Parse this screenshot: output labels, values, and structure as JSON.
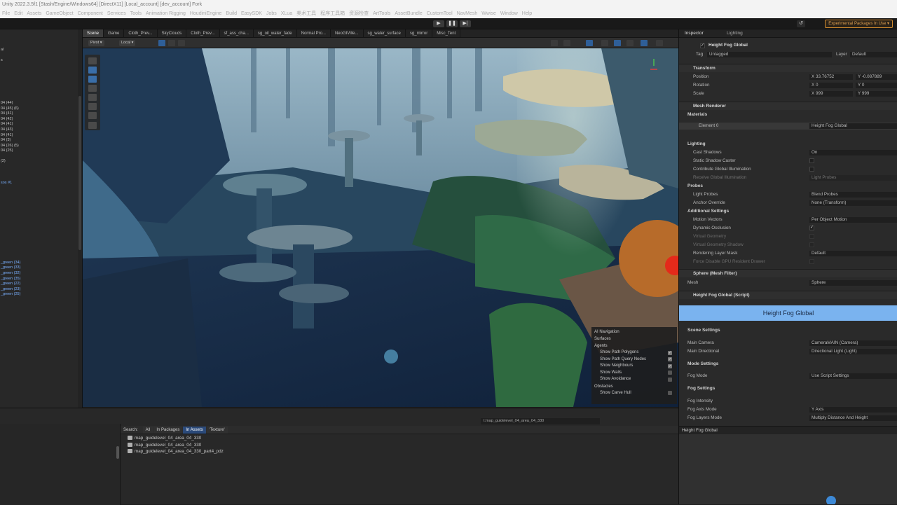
{
  "window": {
    "title": "Unity 2022.3.5f1  [Stash/Engine/Windows64]  [DirectX11]  [Local_account]  [dev_account]  Fork"
  },
  "menu": [
    "File",
    "Edit",
    "Assets",
    "GameObject",
    "Component",
    "Services",
    "Tools",
    "Animation Rigging",
    "HoudiniEngine",
    "Build",
    "EasySDK",
    "Jobs",
    "XLua",
    "美术工具",
    "程序工具箱",
    "资源检查",
    "ArtTools",
    "AssetBundle",
    "CustomTool",
    "NavMesh",
    "Wwise",
    "Window",
    "Help"
  ],
  "toolbar": {
    "experimental_badge": "Experimental Packages In Use ▾"
  },
  "hierarchy": {
    "rows": [
      {
        "text": "al",
        "blue": false
      },
      {
        "text": "",
        "": ""
      },
      {
        "text": "s",
        "blue": false
      },
      {
        "text": "",
        "blue": false
      },
      {
        "text": "",
        "blue": false
      },
      {
        "text": "",
        "blue": false
      },
      {
        "text": "",
        "blue": false
      },
      {
        "text": "",
        "blue": false
      },
      {
        "text": "",
        "blue": false
      },
      {
        "text": "",
        "blue": false
      },
      {
        "text": "04 (44)",
        "blue": false
      },
      {
        "text": "04 (45) (6)",
        "blue": false
      },
      {
        "text": "04 (41)",
        "blue": false
      },
      {
        "text": "04 (42)",
        "blue": false
      },
      {
        "text": "04 (41)",
        "blue": false
      },
      {
        "text": "04 (43)",
        "blue": false
      },
      {
        "text": "04 (41)",
        "blue": false
      },
      {
        "text": "04 (3)",
        "blue": false
      },
      {
        "text": "04 (26) (5)",
        "blue": false
      },
      {
        "text": "04 (25)",
        "blue": false
      },
      {
        "text": "",
        "blue": false
      },
      {
        "text": "(2)",
        "blue": false
      },
      {
        "text": "",
        "blue": false
      },
      {
        "text": "",
        "blue": false
      },
      {
        "text": "",
        "blue": false
      },
      {
        "text": "sos #1",
        "blue": true
      },
      {
        "text": "",
        "blue": false
      },
      {
        "text": "",
        "blue": false
      },
      {
        "text": "",
        "blue": false
      },
      {
        "text": "",
        "blue": false
      },
      {
        "text": "",
        "blue": false
      },
      {
        "text": "",
        "blue": false
      },
      {
        "text": "",
        "blue": false
      },
      {
        "text": "",
        "blue": false
      },
      {
        "text": "",
        "blue": false
      },
      {
        "text": "",
        "blue": false
      },
      {
        "text": "",
        "blue": false
      },
      {
        "text": "",
        "blue": false
      },
      {
        "text": "",
        "blue": false
      },
      {
        "text": "",
        "blue": false
      },
      {
        "text": "_green (34)",
        "blue": true
      },
      {
        "text": "_green (33)",
        "blue": true
      },
      {
        "text": "_green (32)",
        "blue": true
      },
      {
        "text": "_green (35)",
        "blue": true
      },
      {
        "text": "_green (22)",
        "blue": true
      },
      {
        "text": "_green (23)",
        "blue": true
      },
      {
        "text": "_green (25)",
        "blue": true
      },
      {
        "text": "",
        "blue": false
      },
      {
        "text": "",
        "blue": false
      },
      {
        "text": "",
        "blue": false
      },
      {
        "text": "",
        "blue": false
      },
      {
        "text": "",
        "blue": false
      },
      {
        "text": "",
        "blue": false
      },
      {
        "text": "",
        "blue": false
      },
      {
        "text": "",
        "blue": false
      },
      {
        "text": "",
        "blue": false
      },
      {
        "text": "",
        "blue": false
      },
      {
        "text": "",
        "blue": false
      },
      {
        "text": "",
        "blue": false
      },
      {
        "text": "",
        "blue": false
      },
      {
        "text": "",
        "blue": false
      },
      {
        "text": "",
        "blue": false
      },
      {
        "text": "",
        "blue": false
      },
      {
        "text": "",
        "blue": false
      },
      {
        "text": "",
        "blue": false
      },
      {
        "text": "",
        "blue": false
      },
      {
        "text": "",
        "blue": false
      },
      {
        "text": "",
        "blue": false
      },
      {
        "text": "",
        "blue": false
      },
      {
        "text": "",
        "blue": false
      },
      {
        "text": "",
        "blue": false
      },
      {
        "text": "",
        "blue": false
      },
      {
        "text": "",
        "blue": false
      },
      {
        "text": "",
        "blue": false
      },
      {
        "text": "",
        "blue": false
      },
      {
        "text": "",
        "blue": false
      },
      {
        "text": "",
        "blue": false
      },
      {
        "text": "",
        "blue": false
      },
      {
        "text": "",
        "blue": false
      },
      {
        "text": "",
        "blue": false
      }
    ]
  },
  "scene": {
    "tabs": [
      "Scene",
      "Game",
      "Cloth_Prev...",
      "SkyClouds",
      "Cloth_Prev...",
      "sf_ass_cha...",
      "sg_oil_water_fade",
      "Normal Pro...",
      "NeoGIVille...",
      "sg_water_surface",
      "sg_mirror",
      "Misc_Tent"
    ],
    "tools": {
      "pivot": "Pivot",
      "local": "Local"
    }
  },
  "ai_nav": {
    "title": "AI Navigation",
    "surfaces": "Surfaces",
    "agents": "Agents",
    "items": [
      "Show Path Polygons",
      "Show Path Query Nodes",
      "Show Neighbours",
      "Show Walls",
      "Show Avoidance"
    ],
    "checked": [
      true,
      true,
      true,
      false,
      false
    ],
    "obstacles": "Obstacles",
    "carve": "Show Carve Hull"
  },
  "project": {
    "search_label": "Search:",
    "filters": [
      "All",
      "In Packages",
      "In Assets",
      "'Texture'"
    ],
    "path": "t:map_guidelevel_04_area_04_330",
    "files": [
      "map_guidelevel_04_area_04_330",
      "map_guidelevel_04_area_04_330",
      "map_guidelevel_04_area_04_330_part4_pdz"
    ]
  },
  "inspector": {
    "tabs": [
      "Inspector",
      "Lighting"
    ],
    "object_name": "Height Fog Global",
    "tag_label": "Tag",
    "tag": "Untagged",
    "layer_label": "Layer",
    "layer": "Default",
    "transform": {
      "title": "Transform",
      "position": "Position",
      "rotation": "Rotation",
      "scale": "Scale",
      "px": "X  33.76752",
      "py": "Y  -0.087889",
      "rx": "X  0",
      "ry": "Y  0",
      "sx": "X  999",
      "sy": "Y  999"
    },
    "mesh_renderer": {
      "title": "Mesh Renderer",
      "materials": "Materials",
      "element0": "Element 0",
      "element0_val": "Height Fog Global",
      "lighting": "Lighting",
      "cast_shadows": "Cast Shadows",
      "cast_shadows_val": "On",
      "static_caster": "Static Shadow Caster",
      "contribute_gi": "Contribute Global Illumination",
      "receive_gi": "Receive Global Illumination",
      "receive_gi_val": "Light Probes",
      "probes": "Probes",
      "light_probes": "Light Probes",
      "light_probes_val": "Blend Probes",
      "anchor": "Anchor Override",
      "anchor_val": "None (Transform)",
      "additional": "Additional Settings",
      "motion": "Motion Vectors",
      "motion_val": "Per Object Motion",
      "dyn_occ": "Dynamic Occlusion",
      "virt_geo": "Virtual Geometry",
      "virt_geo_shadow": "Virtual Geometry Shadow",
      "rlm": "Rendering Layer Mask",
      "rlm_val": "Default",
      "force_gpu": "Force Disable GPU Resident Drawer"
    },
    "mesh_filter": {
      "title": "Sphere (Mesh Filter)",
      "mesh": "Mesh",
      "mesh_val": "Sphere"
    },
    "script": {
      "title": "Height Fog Global (Script)",
      "button": "Height Fog Global"
    },
    "scene_settings": {
      "title": "Scene Settings",
      "main_camera": "Main Camera",
      "main_camera_val": "CameraMAIN (Camera)",
      "main_dir": "Main Directional",
      "main_dir_val": "Directional Light (Light)"
    },
    "mode_settings": {
      "title": "Mode Settings",
      "fog_mode": "Fog Mode",
      "fog_mode_val": "Use Script Settings"
    },
    "fog_settings": {
      "title": "Fog Settings",
      "intensity": "Fog Intensity",
      "axis_mode": "Fog Axis Mode",
      "axis_mode_val": "Y Axis",
      "layers_mode": "Fog Layers Mode",
      "layers_mode_val": "Multiply Distance And Height"
    },
    "preview_title": "Height Fog Global"
  },
  "colors": {
    "accent": "#7ab3ef",
    "selection": "#2f5f98",
    "warning": "#d08a2e"
  }
}
